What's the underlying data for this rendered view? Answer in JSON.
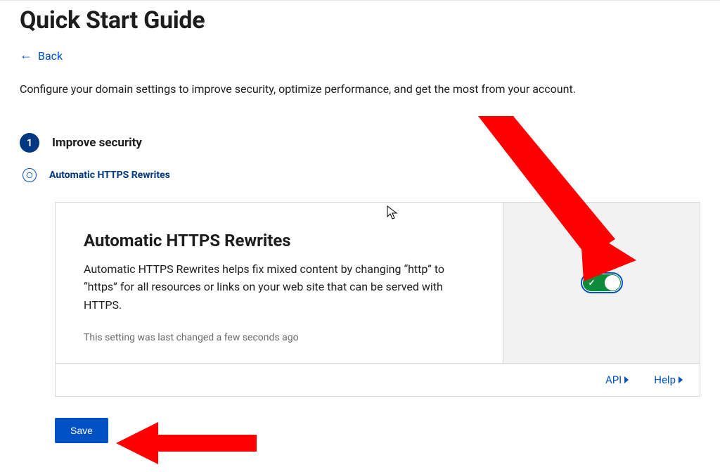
{
  "page": {
    "title": "Quick Start Guide",
    "back_label": "Back",
    "description": "Configure your domain settings to improve security, optimize performance, and get the most from your account."
  },
  "step": {
    "number": "1",
    "title": "Improve security"
  },
  "substep": {
    "title": "Automatic HTTPS Rewrites"
  },
  "card": {
    "heading": "Automatic HTTPS Rewrites",
    "text": "Automatic HTTPS Rewrites helps fix mixed content by changing “http” to “https” for all resources or links on your web site that can be served with HTTPS.",
    "meta": "This setting was last changed a few seconds ago",
    "toggle_state": "on"
  },
  "footer": {
    "api_label": "API",
    "help_label": "Help"
  },
  "actions": {
    "save_label": "Save"
  },
  "colors": {
    "accent": "#0051c3",
    "step_bg": "#003782",
    "toggle_on": "#0d8a3a",
    "annotation": "#ff0000"
  }
}
